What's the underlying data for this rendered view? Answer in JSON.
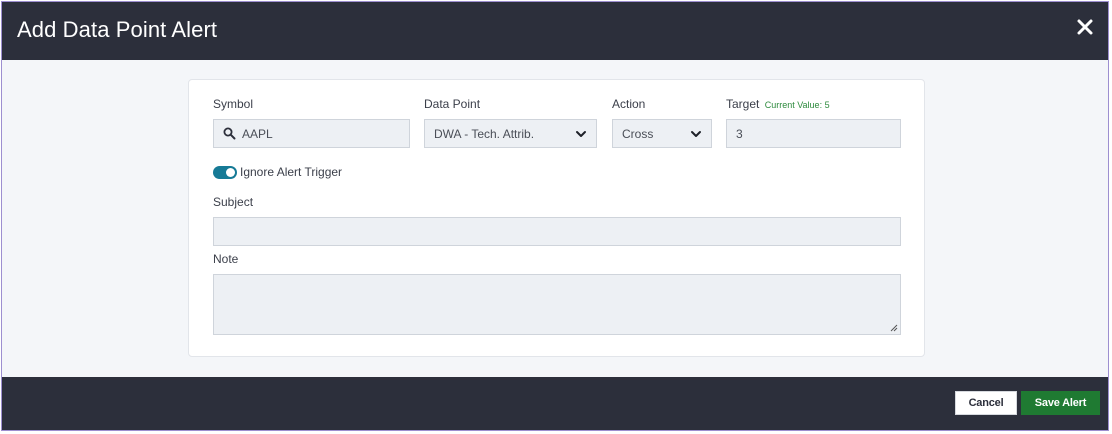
{
  "modal": {
    "title": "Add Data Point Alert"
  },
  "form": {
    "symbol": {
      "label": "Symbol",
      "value": "AAPL"
    },
    "data_point": {
      "label": "Data Point",
      "selected": "DWA - Tech. Attrib."
    },
    "action": {
      "label": "Action",
      "selected": "Cross"
    },
    "target": {
      "label": "Target",
      "current_value_label": "Current Value: 5",
      "value": "3"
    },
    "ignore_trigger": {
      "label": "Ignore Alert Trigger",
      "enabled": true
    },
    "subject": {
      "label": "Subject",
      "value": ""
    },
    "note": {
      "label": "Note",
      "value": ""
    }
  },
  "footer": {
    "cancel_label": "Cancel",
    "save_label": "Save Alert"
  },
  "colors": {
    "header_bg": "#2c2f3b",
    "toggle_on": "#167a96",
    "save_button": "#1f7a32",
    "current_value_text": "#2e8b3e"
  },
  "icons": {
    "close": "close-icon",
    "search": "search-icon",
    "dropdown": "chevron-down-icon"
  }
}
